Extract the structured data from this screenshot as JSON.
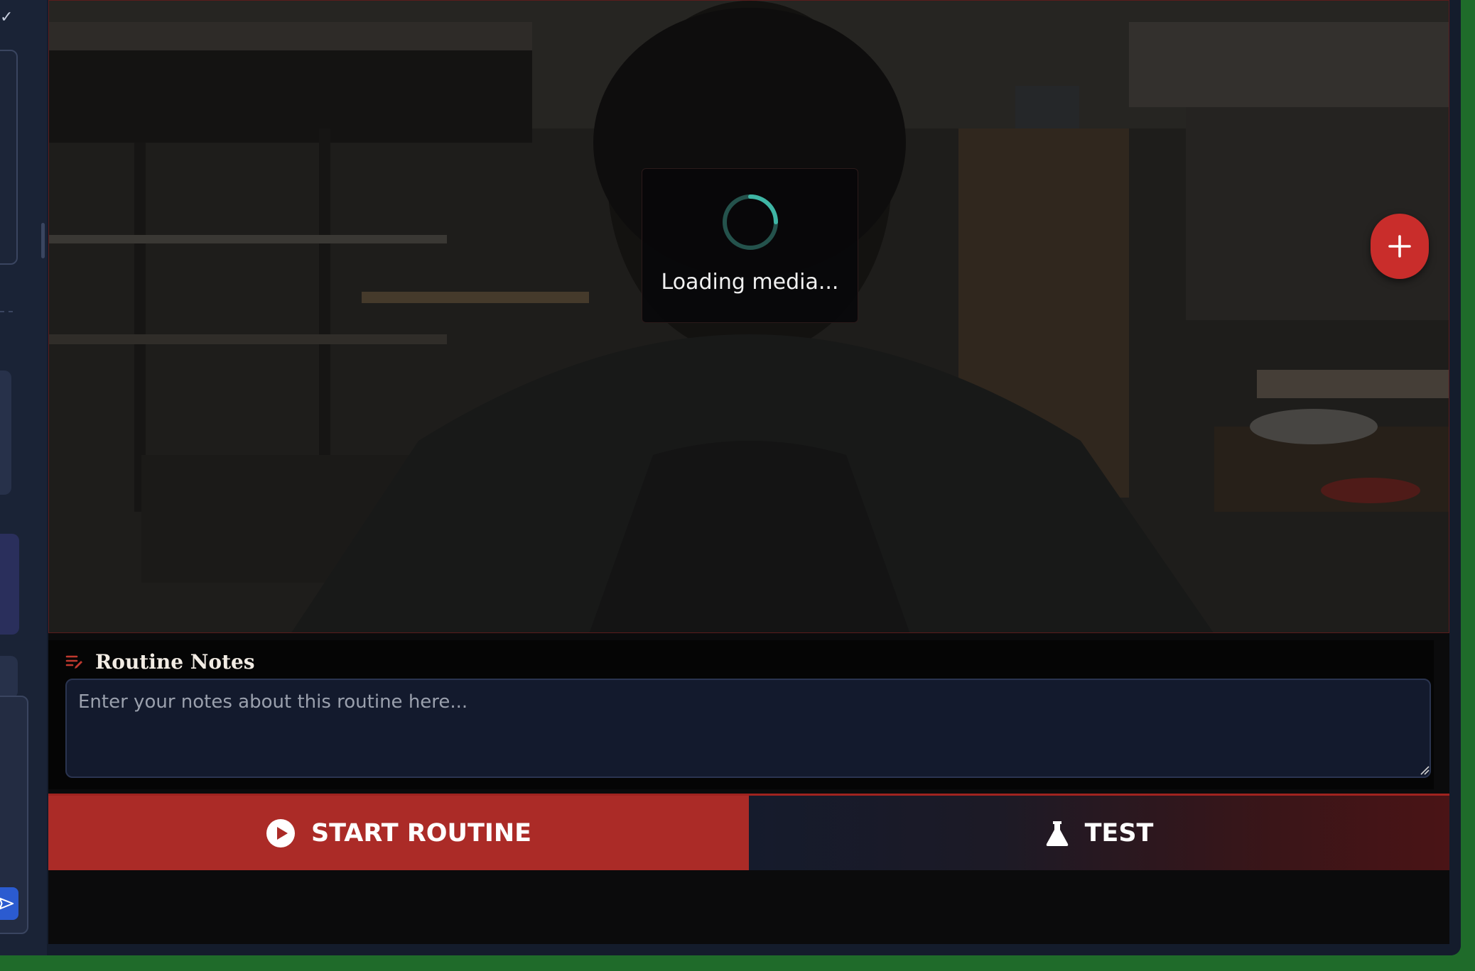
{
  "video": {
    "loading_text": "Loading media..."
  },
  "notes": {
    "title": "Routine Notes",
    "placeholder": "Enter your notes about this routine here...",
    "value": ""
  },
  "actions": {
    "start_label": "START ROUTINE",
    "test_label": "TEST"
  },
  "icons": {
    "add": "plus-icon",
    "notes": "edit-notes-icon",
    "start": "play-circle-icon",
    "test": "flask-icon",
    "send": "send-icon",
    "check": "check-icon"
  },
  "colors": {
    "accent_red": "#ab2b27",
    "fab_red": "#c92d2b",
    "spinner_teal": "#3fb5a5",
    "send_blue": "#2b5bd0"
  }
}
